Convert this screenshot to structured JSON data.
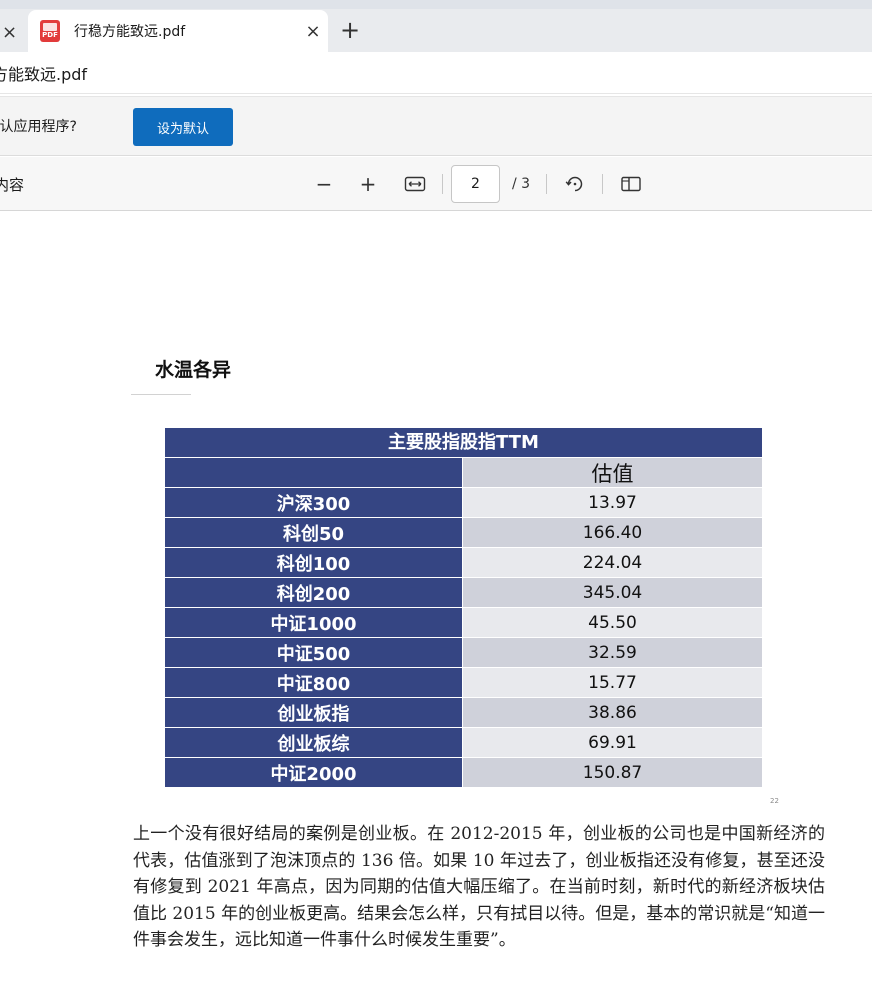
{
  "tabs": {
    "prev_close": "×",
    "active_title": "行稳方能致远.pdf",
    "active_close": "×",
    "new_tab": "+",
    "pdf_icon_text": "PDF"
  },
  "address": {
    "text": "方能致远.pdf"
  },
  "infobar": {
    "message": "t认应用程序?",
    "button": "设为默认"
  },
  "toolbar": {
    "toc_label": "内容",
    "zoom_out": "−",
    "zoom_in": "+",
    "page_current": "2",
    "page_total": "/ 3"
  },
  "document": {
    "heading": "水温各异",
    "table": {
      "title": "主要股指股指TTM",
      "header": [
        "",
        "估值"
      ],
      "rows": [
        [
          "沪深300",
          "13.97"
        ],
        [
          "科创50",
          "166.40"
        ],
        [
          "科创100",
          "224.04"
        ],
        [
          "科创200",
          "345.04"
        ],
        [
          "中证1000",
          "45.50"
        ],
        [
          "中证500",
          "32.59"
        ],
        [
          "中证800",
          "15.77"
        ],
        [
          "创业板指",
          "38.86"
        ],
        [
          "创业板综",
          "69.91"
        ],
        [
          "中证2000",
          "150.87"
        ]
      ]
    },
    "page_number": "22",
    "paragraph": "上一个没有很好结局的案例是创业板。在 2012-2015 年，创业板的公司也是中国新经济的代表，估值涨到了泡沫顶点的 136 倍。如果 10 年过去了，创业板指还没有修复，甚至还没有修复到 2021 年高点，因为同期的估值大幅压缩了。在当前时刻，新时代的新经济板块估值比 2015 年的创业板更高。结果会怎么样，只有拭目以待。但是，基本的常识就是“知道一件事会发生，远比知道一件事什么时候发生重要”。"
  },
  "colors": {
    "table_header": "#354583",
    "accent_button": "#0f6cbd",
    "pdf_icon": "#e23b3b"
  }
}
